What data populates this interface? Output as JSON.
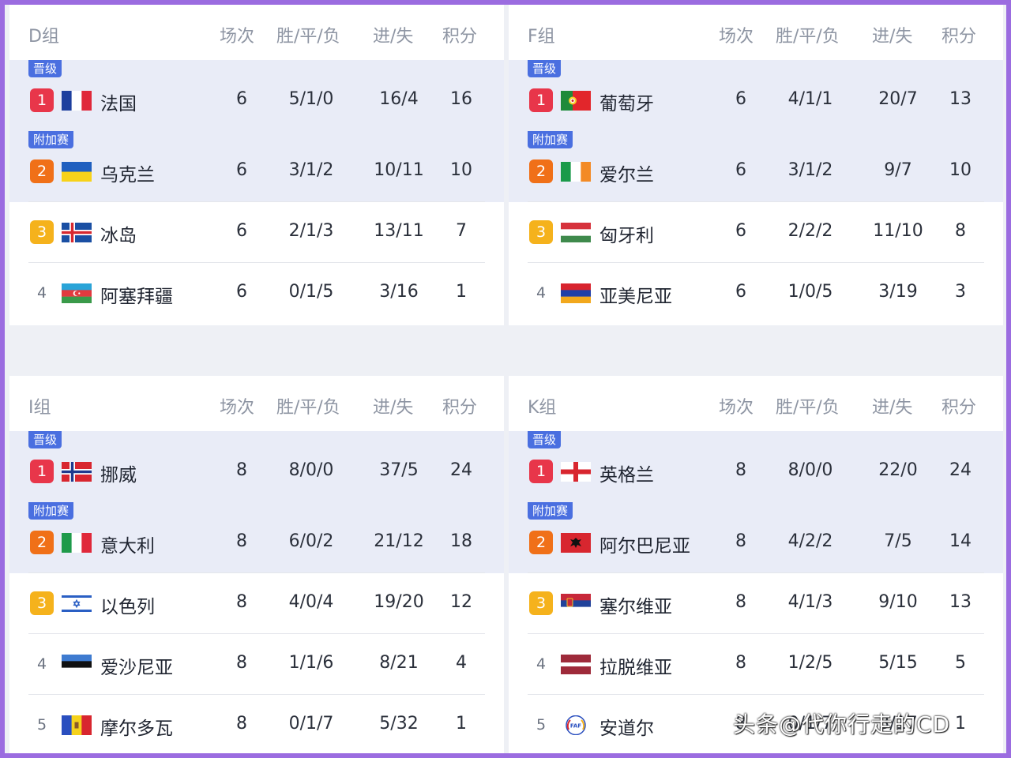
{
  "watermark": "头条@代你行走的CD",
  "columns": {
    "played": "场次",
    "wdl": "胜/平/负",
    "goals": "进/失",
    "points": "积分"
  },
  "groups": [
    {
      "name": "D组",
      "rows": [
        {
          "tag": "晋级",
          "rank": "1",
          "team": "法国",
          "flag": "france",
          "played": "6",
          "wdl": "5/1/0",
          "goals": "16/4",
          "points": "16"
        },
        {
          "tag": "附加赛",
          "rank": "2",
          "team": "乌克兰",
          "flag": "ukraine",
          "played": "6",
          "wdl": "3/1/2",
          "goals": "10/11",
          "points": "10"
        },
        {
          "rank": "3",
          "team": "冰岛",
          "flag": "iceland",
          "played": "6",
          "wdl": "2/1/3",
          "goals": "13/11",
          "points": "7"
        },
        {
          "rank": "4",
          "team": "阿塞拜疆",
          "flag": "azerbaijan",
          "played": "6",
          "wdl": "0/1/5",
          "goals": "3/16",
          "points": "1"
        }
      ]
    },
    {
      "name": "F组",
      "rows": [
        {
          "tag": "晋级",
          "rank": "1",
          "team": "葡萄牙",
          "flag": "portugal",
          "played": "6",
          "wdl": "4/1/1",
          "goals": "20/7",
          "points": "13"
        },
        {
          "tag": "附加赛",
          "rank": "2",
          "team": "爱尔兰",
          "flag": "ireland",
          "played": "6",
          "wdl": "3/1/2",
          "goals": "9/7",
          "points": "10"
        },
        {
          "rank": "3",
          "team": "匈牙利",
          "flag": "hungary",
          "played": "6",
          "wdl": "2/2/2",
          "goals": "11/10",
          "points": "8"
        },
        {
          "rank": "4",
          "team": "亚美尼亚",
          "flag": "armenia",
          "played": "6",
          "wdl": "1/0/5",
          "goals": "3/19",
          "points": "3"
        }
      ]
    },
    {
      "name": "I组",
      "rows": [
        {
          "tag": "晋级",
          "rank": "1",
          "team": "挪威",
          "flag": "norway",
          "played": "8",
          "wdl": "8/0/0",
          "goals": "37/5",
          "points": "24"
        },
        {
          "tag": "附加赛",
          "rank": "2",
          "team": "意大利",
          "flag": "italy",
          "played": "8",
          "wdl": "6/0/2",
          "goals": "21/12",
          "points": "18"
        },
        {
          "rank": "3",
          "team": "以色列",
          "flag": "israel",
          "played": "8",
          "wdl": "4/0/4",
          "goals": "19/20",
          "points": "12"
        },
        {
          "rank": "4",
          "team": "爱沙尼亚",
          "flag": "estonia",
          "played": "8",
          "wdl": "1/1/6",
          "goals": "8/21",
          "points": "4"
        },
        {
          "rank": "5",
          "team": "摩尔多瓦",
          "flag": "moldova",
          "played": "8",
          "wdl": "0/1/7",
          "goals": "5/32",
          "points": "1"
        }
      ]
    },
    {
      "name": "K组",
      "rows": [
        {
          "tag": "晋级",
          "rank": "1",
          "team": "英格兰",
          "flag": "england",
          "played": "8",
          "wdl": "8/0/0",
          "goals": "22/0",
          "points": "24"
        },
        {
          "tag": "附加赛",
          "rank": "2",
          "team": "阿尔巴尼亚",
          "flag": "albania",
          "played": "8",
          "wdl": "4/2/2",
          "goals": "7/5",
          "points": "14"
        },
        {
          "rank": "3",
          "team": "塞尔维亚",
          "flag": "serbia",
          "played": "8",
          "wdl": "4/1/3",
          "goals": "9/10",
          "points": "13"
        },
        {
          "rank": "4",
          "team": "拉脱维亚",
          "flag": "latvia",
          "played": "8",
          "wdl": "1/2/5",
          "goals": "5/15",
          "points": "5"
        },
        {
          "rank": "5",
          "team": "安道尔",
          "flag": "andorra",
          "played": "8",
          "wdl": "0/1/7",
          "goals": "3/17",
          "points": "1"
        }
      ]
    }
  ]
}
